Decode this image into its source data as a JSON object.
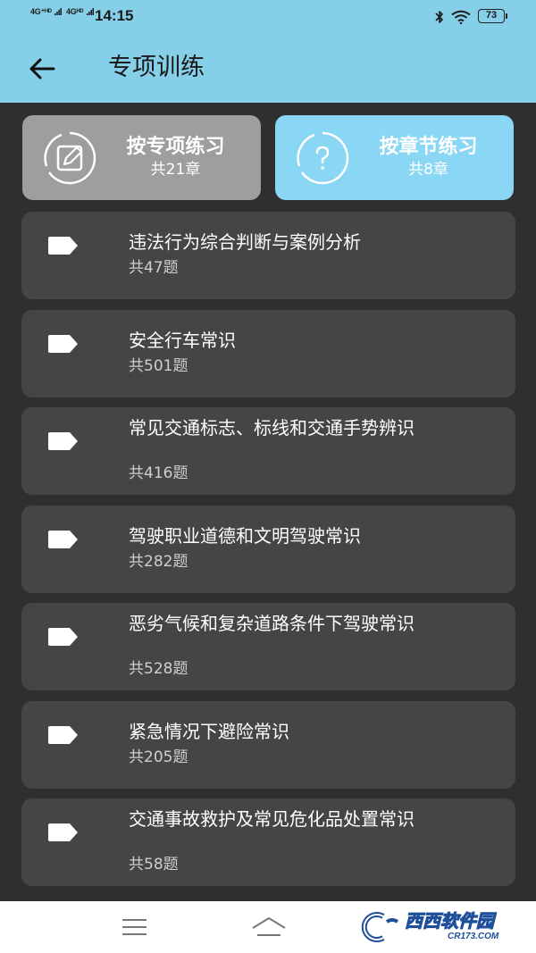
{
  "status_bar": {
    "network_1": "4G⁺ᴴᴰ",
    "network_2": "4Gᴴᴰ",
    "time": "14:15",
    "battery": "73",
    "icons": [
      "bluetooth-icon",
      "wifi-icon",
      "battery-icon"
    ]
  },
  "app_bar": {
    "title": "专项训练",
    "back_icon": "arrow-left-icon"
  },
  "modes": {
    "topic": {
      "label": "按专项练习",
      "sub": "共21章",
      "icon": "edit-note-icon"
    },
    "chapter": {
      "label": "按章节练习",
      "sub": "共8章",
      "icon": "question-circle-icon"
    }
  },
  "items": [
    {
      "name": "违法行为综合判断与案例分析",
      "count": "共47题"
    },
    {
      "name": "安全行车常识",
      "count": "共501题"
    },
    {
      "name": "常见交通标志、标线和交通手势辨识",
      "count": "共416题"
    },
    {
      "name": "驾驶职业道德和文明驾驶常识",
      "count": "共282题"
    },
    {
      "name": "恶劣气候和复杂道路条件下驾驶常识",
      "count": "共528题"
    },
    {
      "name": "紧急情况下避险常识",
      "count": "共205题"
    },
    {
      "name": "交通事故救护及常见危化品处置常识",
      "count": "共58题"
    }
  ],
  "watermark": {
    "text": "西西软件园",
    "url": "CR173.COM"
  },
  "colors": {
    "accent": "#86cfe9",
    "background": "#2f2f2f",
    "card": "#454545",
    "topic_button": "#9e9e9e",
    "chapter_button": "#8ad6f5"
  }
}
